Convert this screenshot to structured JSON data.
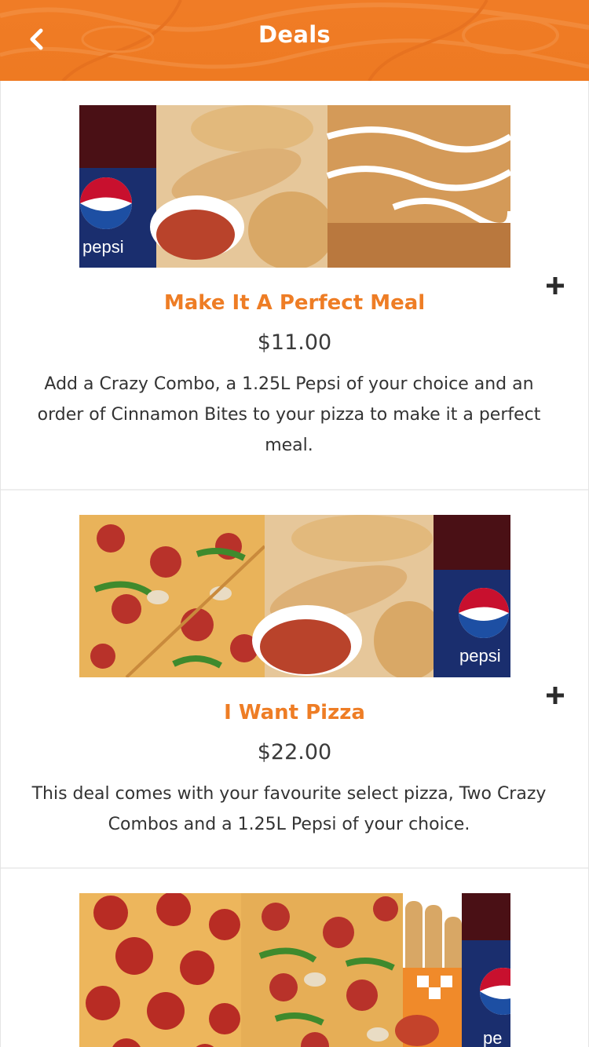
{
  "header": {
    "title": "Deals",
    "back_icon": "chevron-left-icon",
    "background_color": "#ee7a22"
  },
  "deals": [
    {
      "title": "Make It A Perfect Meal",
      "price": "$11.00",
      "description": "Add a Crazy Combo, a 1.25L Pepsi of your choice and an order of Cinnamon Bites to your pizza to make it a perfect meal.",
      "image_text": "pepsi",
      "add_icon": "plus-icon"
    },
    {
      "title": "I Want Pizza",
      "price": "$22.00",
      "description": "This deal comes with your favourite select pizza, Two Crazy Combos and a 1.25L Pepsi of your choice.",
      "image_text": "pepsi",
      "add_icon": "plus-icon"
    },
    {
      "title": "",
      "price": "",
      "description": "",
      "image_text": "pe",
      "add_icon": "plus-icon"
    }
  ],
  "colors": {
    "accent": "#ee7d25",
    "text": "#3a3a3a"
  }
}
